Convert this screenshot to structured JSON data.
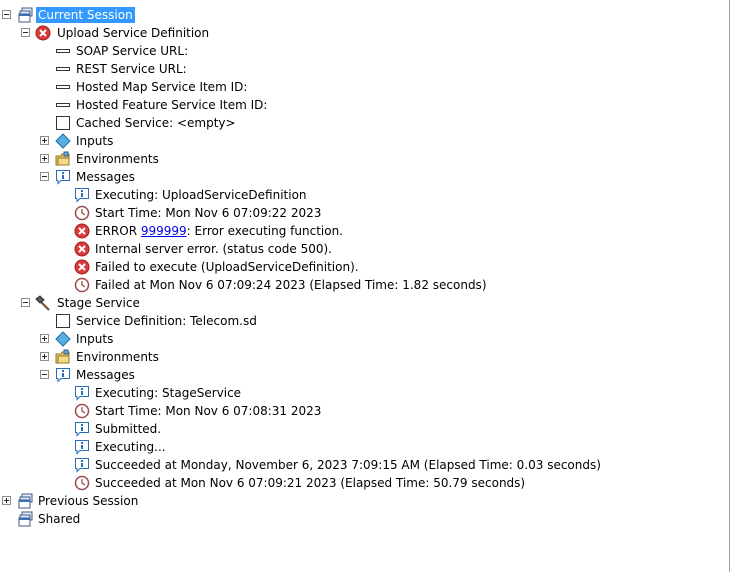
{
  "tree": {
    "current_session": "Current Session",
    "upload": {
      "title": "Upload Service Definition",
      "soap_url": "SOAP Service URL:",
      "rest_url": "REST Service URL:",
      "map_item": "Hosted Map Service Item ID:",
      "feature_item": "Hosted Feature Service Item ID:",
      "cached": "Cached Service: <empty>",
      "inputs": "Inputs",
      "environments": "Environments",
      "messages": "Messages",
      "msg_executing": "Executing: UploadServiceDefinition",
      "msg_start": "Start Time: Mon Nov  6 07:09:22 2023",
      "msg_error_prefix": "ERROR ",
      "msg_error_code": "999999",
      "msg_error_suffix": ": Error executing function.",
      "msg_internal": "Internal server error. (status code 500).",
      "msg_failed_exec": "Failed to execute (UploadServiceDefinition).",
      "msg_failed_at": "Failed at Mon Nov  6 07:09:24 2023 (Elapsed Time: 1.82 seconds)"
    },
    "stage": {
      "title": "Stage Service",
      "service_def": "Service Definition: Telecom.sd",
      "inputs": "Inputs",
      "environments": "Environments",
      "messages": "Messages",
      "msg_executing": "Executing: StageService",
      "msg_start": "Start Time: Mon Nov  6 07:08:31 2023",
      "msg_submitted": "Submitted.",
      "msg_executing2": "Executing...",
      "msg_succeeded": "Succeeded at Monday, November 6, 2023 7:09:15 AM (Elapsed Time: 0.03 seconds)",
      "msg_succeeded2": "Succeeded at Mon Nov  6 07:09:21 2023 (Elapsed Time: 50.79 seconds)"
    },
    "previous_session": "Previous Session",
    "shared": "Shared"
  }
}
